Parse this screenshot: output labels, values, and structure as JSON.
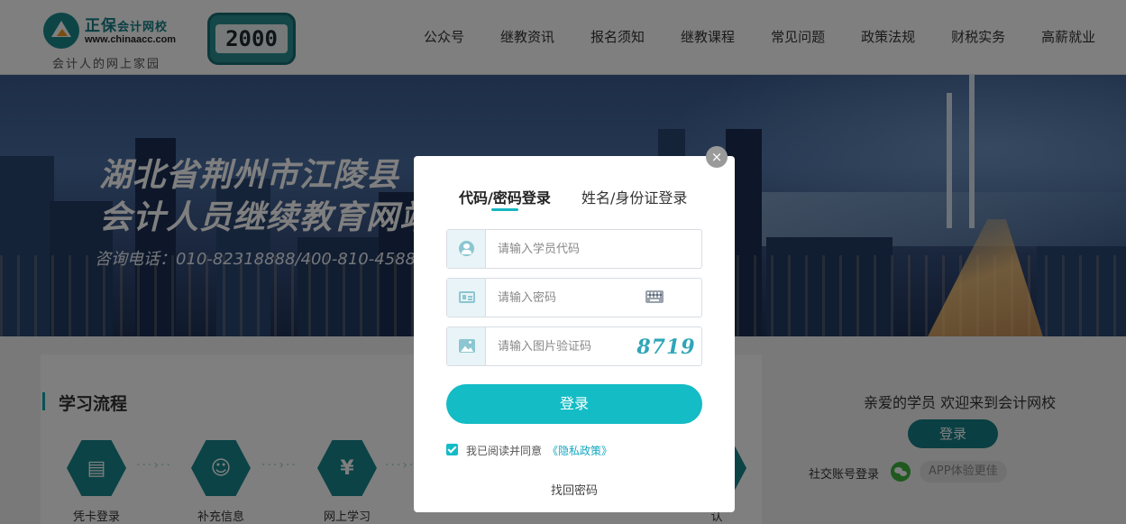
{
  "header": {
    "brand": "正保",
    "brand_sub": "会计网校",
    "url": "www.chinaacc.com",
    "slogan": "会计人的网上家园",
    "badge_number": "2000",
    "nav": [
      "公众号",
      "继教资讯",
      "报名须知",
      "继教课程",
      "常见问题",
      "政策法规",
      "财税实务",
      "高薪就业"
    ]
  },
  "banner": {
    "title_line1": "湖北省荆州市江陵县",
    "title_line2": "会计人员继续教育网站",
    "phone": "咨询电话：010-82318888/400-810-4588"
  },
  "process": {
    "title": "学习流程",
    "steps": [
      {
        "label": "凭卡登录",
        "icon": "card-list-icon"
      },
      {
        "label": "补充信息",
        "icon": "user-check-icon"
      },
      {
        "label": "网上学习",
        "icon": "money-bag-icon"
      },
      {
        "label": "认",
        "icon": "dollar-icon"
      }
    ],
    "connector": "···›··"
  },
  "sidebar": {
    "welcome": "亲爱的学员 欢迎来到会计网校",
    "login_label": "登录",
    "social_label": "社交账号登录",
    "app_label": "APP体验更佳"
  },
  "modal": {
    "close_glyph": "×",
    "tab_code": "代码/密码登录",
    "tab_name": "姓名/身份证登录",
    "student_code_placeholder": "请输入学员代码",
    "password_placeholder": "请输入密码",
    "captcha_placeholder": "请输入图片验证码",
    "captcha_value": "8719",
    "login_label": "登录",
    "agree_text": "我已阅读并同意",
    "privacy_link": "《隐私政策》",
    "find_password": "找回密码"
  },
  "colors": {
    "accent": "#14bcc5",
    "brand_teal": "#147f86",
    "overlay": "rgba(0,0,0,0.5)"
  }
}
